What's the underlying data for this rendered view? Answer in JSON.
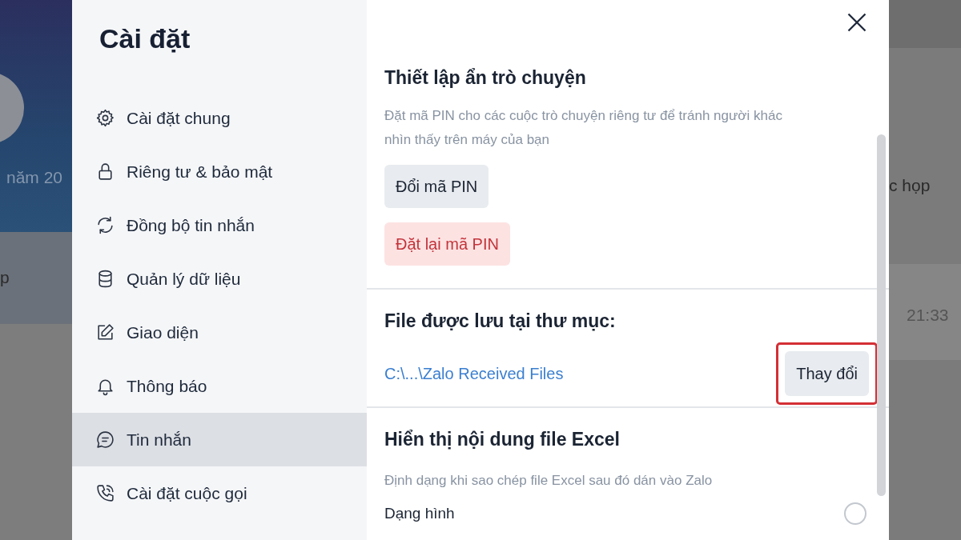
{
  "background": {
    "left_texts": [
      "năm 20",
      "p"
    ],
    "right_texts": [
      "c họp",
      "21:33"
    ]
  },
  "sidebar": {
    "title": "Cài đặt",
    "items": [
      {
        "label": "Cài đặt chung",
        "kind": "gear",
        "selected": false
      },
      {
        "label": "Riêng tư & bảo mật",
        "kind": "lock",
        "selected": false
      },
      {
        "label": "Đồng bộ tin nhắn",
        "kind": "sync",
        "selected": false
      },
      {
        "label": "Quản lý dữ liệu",
        "kind": "database",
        "selected": false
      },
      {
        "label": "Giao diện",
        "kind": "edit",
        "selected": false
      },
      {
        "label": "Thông báo",
        "kind": "bell",
        "selected": false
      },
      {
        "label": "Tin nhắn",
        "kind": "chat",
        "selected": true
      },
      {
        "label": "Cài đặt cuộc gọi",
        "kind": "phone",
        "selected": false
      }
    ]
  },
  "content": {
    "sections": [
      {
        "title": "Thiết lập ẩn trò chuyện",
        "description": "Đặt mã PIN cho các cuộc trò chuyện riêng tư để tránh người khác nhìn thấy trên máy của bạn",
        "buttons": [
          {
            "label": "Đổi mã PIN",
            "kind": "neutral"
          },
          {
            "label": "Đặt lại mã PIN",
            "kind": "danger"
          }
        ]
      },
      {
        "title": "File được lưu tại thư mục:",
        "path": "C:\\...\\Zalo Received Files",
        "action": {
          "label": "Thay đổi",
          "highlighted": true
        }
      },
      {
        "title": "Hiển thị nội dung file Excel",
        "description": "Định dạng khi sao chép file Excel sau đó dán vào Zalo",
        "options": [
          {
            "label": "Dạng hình",
            "selected": false
          }
        ]
      }
    ]
  }
}
